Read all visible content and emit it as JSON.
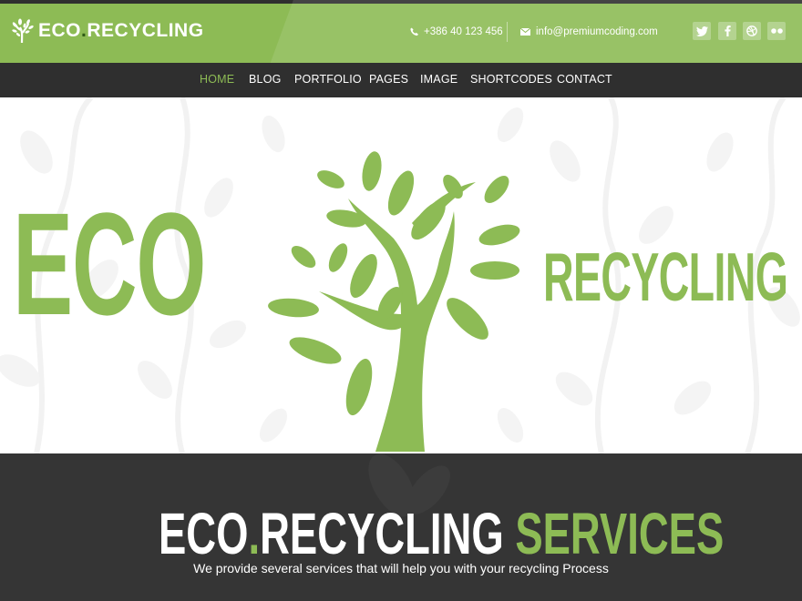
{
  "header": {
    "logo": {
      "prefix": "ECO",
      "dot": ".",
      "suffix": "RECYCLING"
    },
    "phone": "+386 40 123 456",
    "email": "info@premiumcoding.com",
    "social": [
      "twitter-icon",
      "facebook-icon",
      "dribbble-icon",
      "flickr-icon"
    ]
  },
  "nav": {
    "items": [
      "HOME",
      "BLOG",
      "PORTFOLIO",
      "PAGES",
      "IMAGE",
      "SHORTCODES",
      "CONTACT"
    ],
    "active": "HOME"
  },
  "hero": {
    "left_word": "ECO",
    "right_word": "RECYCLING"
  },
  "services": {
    "title_white": "ECO",
    "title_dot": ".",
    "title_white2": "RECYCLING",
    "title_green": "SERVICES",
    "subtitle": "We provide several services that will help you with your recycling Process"
  },
  "colors": {
    "brand_green": "#8dbb55",
    "dark": "#2f2f2f",
    "services_bg": "#353535"
  }
}
